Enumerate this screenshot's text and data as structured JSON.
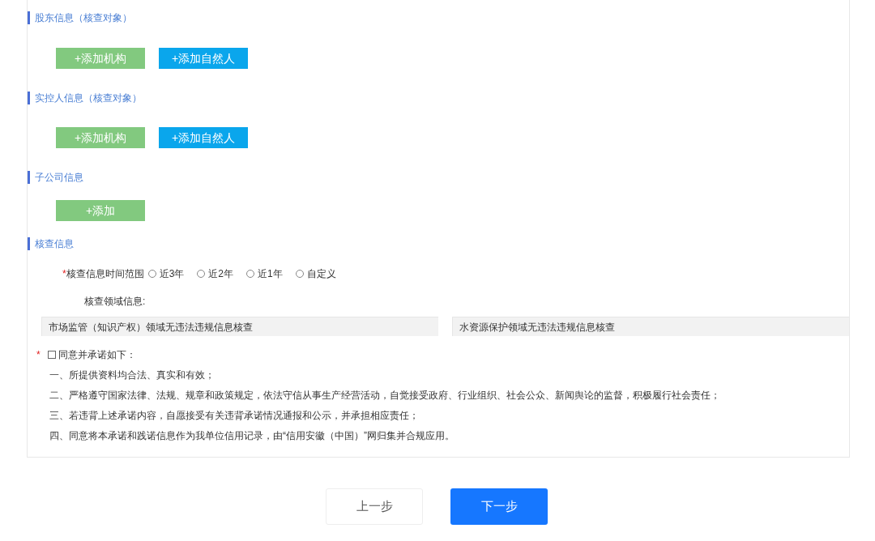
{
  "sections": [
    {
      "title": "股东信息（核查对象）",
      "buttons": [
        {
          "label": "+添加机构",
          "kind": "org"
        },
        {
          "label": "+添加自然人",
          "kind": "person"
        }
      ]
    },
    {
      "title": "实控人信息（核查对象）",
      "buttons": [
        {
          "label": "+添加机构",
          "kind": "org"
        },
        {
          "label": "+添加自然人",
          "kind": "person"
        }
      ]
    },
    {
      "title": "子公司信息",
      "buttons": [
        {
          "label": "+添加",
          "kind": "org"
        }
      ]
    }
  ],
  "check": {
    "title": "核查信息",
    "time_range": {
      "marker": "*",
      "label": "核查信息时间范围",
      "options": [
        {
          "label": "近3年",
          "selected": false
        },
        {
          "label": "近2年",
          "selected": false
        },
        {
          "label": "近1年",
          "selected": false
        },
        {
          "label": "自定义",
          "selected": false
        }
      ]
    },
    "domain": {
      "label": "核查领域信息:",
      "items": [
        "市场监管（知识产权）领域无违法违规信息核查",
        "水资源保护领域无违法违规信息核查"
      ]
    }
  },
  "promise": {
    "marker": "*",
    "checked": false,
    "title": "同意并承诺如下：",
    "lines": [
      "一、所提供资料均合法、真实和有效；",
      "二、严格遵守国家法律、法规、规章和政策规定，依法守信从事生产经营活动，自觉接受政府、行业组织、社会公众、新闻舆论的监督，积极履行社会责任；",
      "三、若违背上述承诺内容，自愿接受有关违背承诺情况通报和公示，并承担相应责任；",
      "四、同意将本承诺和践诺信息作为我单位信用记录，由“信用安徽（中国）”网归集并合规应用。"
    ]
  },
  "footer": [
    {
      "label": "上一步",
      "kind": "secondary"
    },
    {
      "label": "下一步",
      "kind": "primary"
    }
  ]
}
